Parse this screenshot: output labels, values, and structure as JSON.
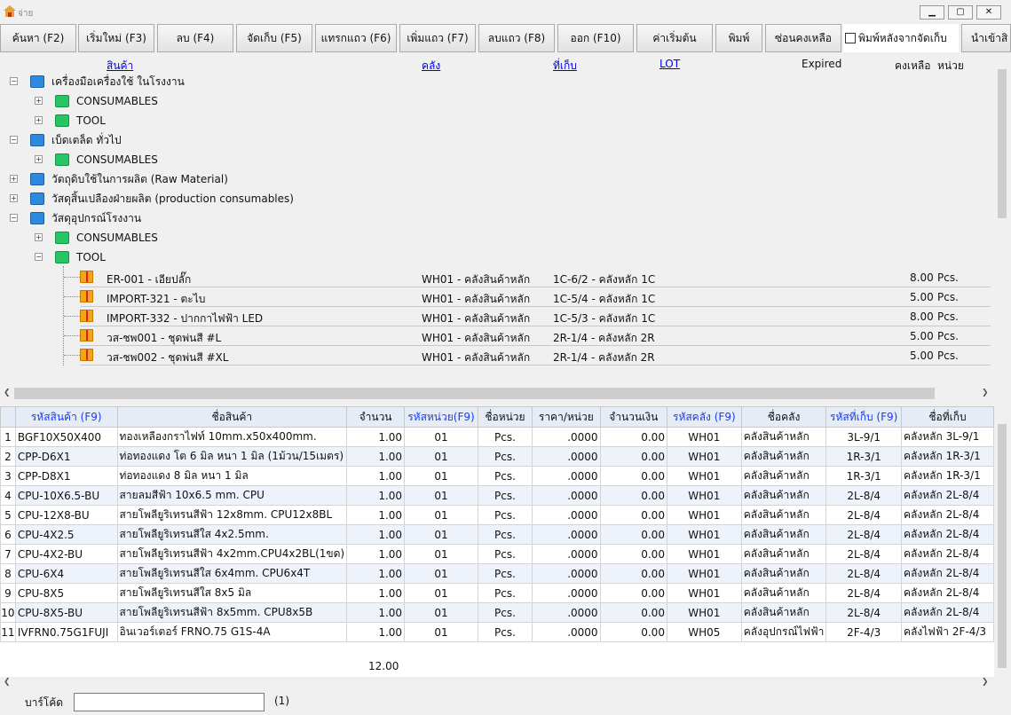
{
  "window": {
    "title": "จ่าย",
    "min": "▁",
    "max": "▢",
    "close": "✕"
  },
  "toolbar": {
    "buttons": [
      "ค้นหา (F2)",
      "เริ่มใหม่ (F3)",
      "ลบ (F4)",
      "จัดเก็บ (F5)",
      "แทรกแถว (F6)",
      "เพิ่มแถว (F7)",
      "ลบแถว (F8)",
      "ออก (F10)",
      "ค่าเริ่มต้น",
      "พิมพ์",
      "ซ่อนคงเหลือ"
    ],
    "print_after_save": "พิมพ์หลังจากจัดเก็บ",
    "import": "นำเข้าสิ"
  },
  "tree": {
    "headers": {
      "product": "สินค้า",
      "warehouse": "คลัง",
      "location": "ที่เก็บ",
      "lot": "LOT",
      "expired": "Expired",
      "remaining": "คงเหลือ",
      "unit": "หน่วย"
    },
    "nodes": [
      {
        "label": "เครื่องมือเครื่องใช้ ในโรงงาน",
        "level": 0,
        "color": "blue",
        "exp": "−"
      },
      {
        "label": "CONSUMABLES",
        "level": 1,
        "color": "green",
        "exp": "+"
      },
      {
        "label": "TOOL",
        "level": 1,
        "color": "green",
        "exp": "+"
      },
      {
        "label": "เบ็ดเตล็ด ทั่วไป",
        "level": 0,
        "color": "blue",
        "exp": "−"
      },
      {
        "label": "CONSUMABLES",
        "level": 1,
        "color": "green",
        "exp": "+"
      },
      {
        "label": "วัตถุดิบใช้ในการผลิต (Raw Material)",
        "level": 0,
        "color": "blue",
        "exp": "+"
      },
      {
        "label": "วัสดุสิ้นเปลืองฝ่ายผลิต (production consumables)",
        "level": 0,
        "color": "blue",
        "exp": "+"
      },
      {
        "label": "วัสดุอุปกรณ์โรงงาน",
        "level": 0,
        "color": "blue",
        "exp": "−"
      },
      {
        "label": "CONSUMABLES",
        "level": 1,
        "color": "green",
        "exp": "+"
      },
      {
        "label": "TOOL",
        "level": 1,
        "color": "green",
        "exp": "−"
      }
    ],
    "items": [
      {
        "name": "ER-001 - เอียปลั๊ก",
        "wh": "WH01 - คลังสินค้าหลัก",
        "loc": "1C-6/2 - คลังหลัก 1C",
        "qty": "8.00",
        "unit": "Pcs."
      },
      {
        "name": "IMPORT-321 - ตะไบ",
        "wh": "WH01 - คลังสินค้าหลัก",
        "loc": "1C-5/4 - คลังหลัก 1C",
        "qty": "5.00",
        "unit": "Pcs."
      },
      {
        "name": "IMPORT-332 - ปากกาไฟฟ้า LED",
        "wh": "WH01 - คลังสินค้าหลัก",
        "loc": "1C-5/3 - คลังหลัก 1C",
        "qty": "8.00",
        "unit": "Pcs."
      },
      {
        "name": "วส-ชพ001 - ชุดพ่นสี #L",
        "wh": "WH01 - คลังสินค้าหลัก",
        "loc": "2R-1/4 - คลังหลัก 2R",
        "qty": "5.00",
        "unit": "Pcs."
      },
      {
        "name": "วส-ชพ002 - ชุดพ่นสี #XL",
        "wh": "WH01 - คลังสินค้าหลัก",
        "loc": "2R-1/4 - คลังหลัก 2R",
        "qty": "5.00",
        "unit": "Pcs."
      }
    ]
  },
  "grid": {
    "headers": [
      "",
      "รหัสสินค้า (F9)",
      "ชื่อสินค้า",
      "จำนวน",
      "รหัสหน่วย(F9)",
      "ชื่อหน่วย",
      "ราคา/หน่วย",
      "จำนวนเงิน",
      "รหัสคลัง (F9)",
      "ชื่อคลัง",
      "รหัสที่เก็บ (F9)",
      "ชื่อที่เก็บ"
    ],
    "rows": [
      [
        "1",
        "BGF10X50X400",
        "ทองเหลืองกราไฟท์ 10mm.x50x400mm.",
        "1.00",
        "01",
        "Pcs.",
        ".0000",
        "0.00",
        "WH01",
        "คลังสินค้าหลัก",
        "3L-9/1",
        "คลังหลัก 3L-9/1"
      ],
      [
        "2",
        "CPP-D6X1",
        "ท่อทองแดง โต 6 มิล หนา 1 มิล (1ม้วน/15เมตร)",
        "1.00",
        "01",
        "Pcs.",
        ".0000",
        "0.00",
        "WH01",
        "คลังสินค้าหลัก",
        "1R-3/1",
        "คลังหลัก 1R-3/1"
      ],
      [
        "3",
        "CPP-D8X1",
        "ท่อทองแดง 8 มิล หนา 1 มิล",
        "1.00",
        "01",
        "Pcs.",
        ".0000",
        "0.00",
        "WH01",
        "คลังสินค้าหลัก",
        "1R-3/1",
        "คลังหลัก 1R-3/1"
      ],
      [
        "4",
        "CPU-10X6.5-BU",
        "สายลมสีฟ้า 10x6.5 mm. CPU",
        "1.00",
        "01",
        "Pcs.",
        ".0000",
        "0.00",
        "WH01",
        "คลังสินค้าหลัก",
        "2L-8/4",
        "คลังหลัก 2L-8/4"
      ],
      [
        "5",
        "CPU-12X8-BU",
        "สายโพลียูริเทรนสีฟ้า 12x8mm. CPU12x8BL",
        "1.00",
        "01",
        "Pcs.",
        ".0000",
        "0.00",
        "WH01",
        "คลังสินค้าหลัก",
        "2L-8/4",
        "คลังหลัก 2L-8/4"
      ],
      [
        "6",
        "CPU-4X2.5",
        "สายโพลียูริเทรนสีใส 4x2.5mm.",
        "1.00",
        "01",
        "Pcs.",
        ".0000",
        "0.00",
        "WH01",
        "คลังสินค้าหลัก",
        "2L-8/4",
        "คลังหลัก 2L-8/4"
      ],
      [
        "7",
        "CPU-4X2-BU",
        "สายโพลียูริเทรนสีฟ้า 4x2mm.CPU4x2BL(1ขด)",
        "1.00",
        "01",
        "Pcs.",
        ".0000",
        "0.00",
        "WH01",
        "คลังสินค้าหลัก",
        "2L-8/4",
        "คลังหลัก 2L-8/4"
      ],
      [
        "8",
        "CPU-6X4",
        "สายโพลียูริเทรนสีใส 6x4mm. CPU6x4T",
        "1.00",
        "01",
        "Pcs.",
        ".0000",
        "0.00",
        "WH01",
        "คลังสินค้าหลัก",
        "2L-8/4",
        "คลังหลัก 2L-8/4"
      ],
      [
        "9",
        "CPU-8X5",
        "สายโพลียูริเทรนสีใส 8x5 มิล",
        "1.00",
        "01",
        "Pcs.",
        ".0000",
        "0.00",
        "WH01",
        "คลังสินค้าหลัก",
        "2L-8/4",
        "คลังหลัก 2L-8/4"
      ],
      [
        "10",
        "CPU-8X5-BU",
        "สายโพลียูริเทรนสีฟ้า 8x5mm. CPU8x5B",
        "1.00",
        "01",
        "Pcs.",
        ".0000",
        "0.00",
        "WH01",
        "คลังสินค้าหลัก",
        "2L-8/4",
        "คลังหลัก 2L-8/4"
      ],
      [
        "11",
        "IVFRN0.75G1FUJI",
        "อินเวอร์เตอร์ FRNO.75 G1S-4A",
        "1.00",
        "01",
        "Pcs.",
        ".0000",
        "0.00",
        "WH05",
        "คลังอุปกรณ์ไฟฟ้า",
        "2F-4/3",
        "คลังไฟฟ้า 2F-4/3"
      ]
    ],
    "total_qty": "12.00"
  },
  "barcode": {
    "label": "บาร์โค้ด",
    "value": "",
    "count": "(1)"
  },
  "colors": {
    "header_link": "#0000ee",
    "grid_header_blue": "#1a3cf0"
  }
}
